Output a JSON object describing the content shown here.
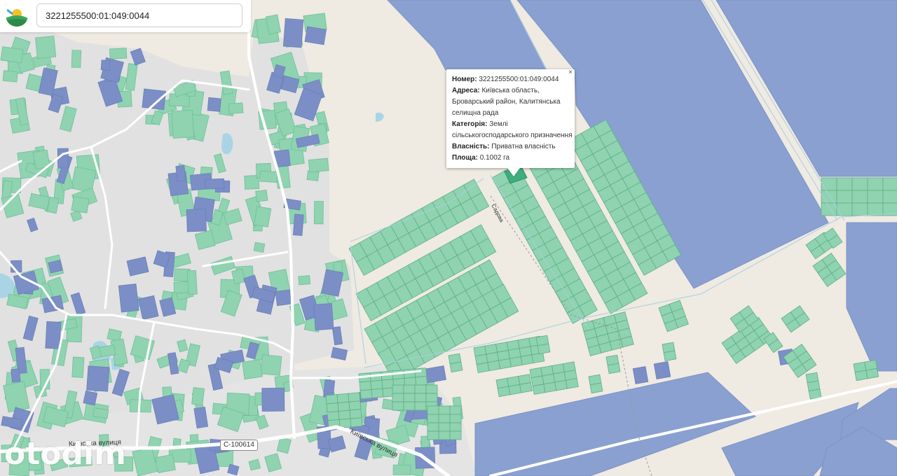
{
  "search": {
    "value": "3221255500:01:049:0044"
  },
  "popup": {
    "close": "×",
    "number_label": "Номер:",
    "number_value": "3221255500:01:049:0044",
    "address_label": "Адреса:",
    "address_value_1": "Київська область,",
    "address_value_2": "Броварський район, Калитянська",
    "address_value_3": "селищна рада",
    "category_label": "Категорія:",
    "category_value_1": "Землі",
    "category_value_2": "сільськогосподарського призначення",
    "ownership_label": "Власність:",
    "ownership_value": "Приватна власність",
    "area_label": "Площа:",
    "area_value": "0.1002 га"
  },
  "map_labels": {
    "street_west": "Київська вулиця",
    "street_east": "Київська вулиця",
    "road_number": "С-100614",
    "lane": "Садова"
  },
  "watermark": "otodim",
  "colors": {
    "private_parcel": "#8fd3b0",
    "state_parcel": "#7b8fc6",
    "large_field": "#8aa0d0",
    "selected_parcel": "#3fae7f",
    "built_area": "#e1e1e1",
    "background": "#efeae2",
    "road": "#ffffff",
    "water": "#a9d4e6"
  },
  "icons": {
    "logo": "logo-icon",
    "close": "close-icon"
  }
}
